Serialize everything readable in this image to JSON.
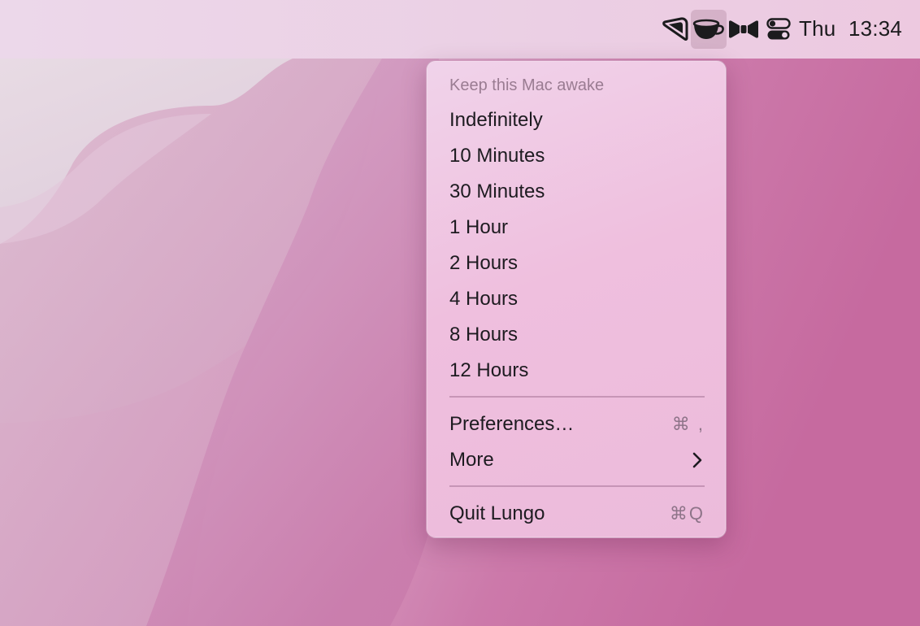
{
  "menubar": {
    "icons": [
      "lasso-icon",
      "coffee-cup-icon",
      "bow-tie-icon",
      "control-center-icon"
    ],
    "day": "Thu",
    "time": "13:34"
  },
  "menu": {
    "header": "Keep this Mac awake",
    "durations": [
      "Indefinitely",
      "10 Minutes",
      "30 Minutes",
      "1 Hour",
      "2 Hours",
      "4 Hours",
      "8 Hours",
      "12 Hours"
    ],
    "preferences_label": "Preferences…",
    "preferences_shortcut": "⌘ ,",
    "more_label": "More",
    "more_icon": "chevron-right-icon",
    "quit_label": "Quit Lungo",
    "quit_shortcut": "⌘Q"
  },
  "colors": {
    "wallpaper_pink": "#c86c9f",
    "menu_background": "#efc3df",
    "menubar_background": "#ecd4e7"
  }
}
